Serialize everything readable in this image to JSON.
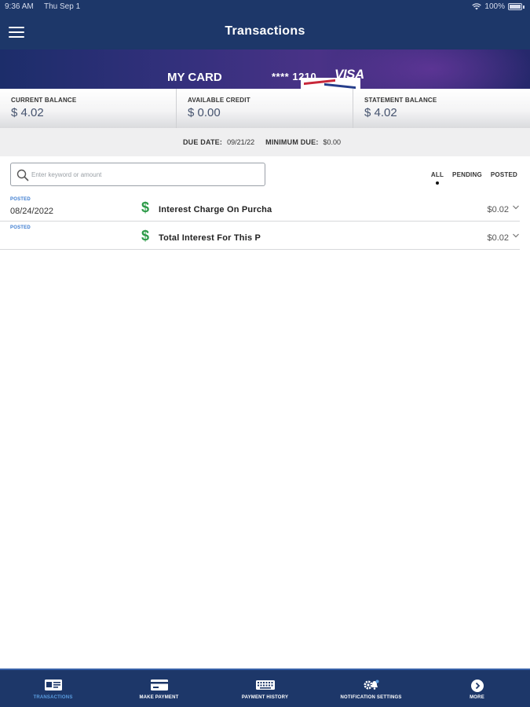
{
  "status_bar": {
    "time": "9:36 AM",
    "date": "Thu Sep 1",
    "battery": "100%"
  },
  "header": {
    "title": "Transactions"
  },
  "card": {
    "name": "MY CARD",
    "number": "**** 1210",
    "brand": "VISA"
  },
  "balances": [
    {
      "label": "CURRENT BALANCE",
      "value": "$ 4.02"
    },
    {
      "label": "AVAILABLE CREDIT",
      "value": "$ 0.00"
    },
    {
      "label": "STATEMENT BALANCE",
      "value": "$ 4.02"
    }
  ],
  "due": {
    "due_label": "DUE DATE:",
    "due_value": "09/21/22",
    "min_label": "MINIMUM DUE:",
    "min_value": "$0.00"
  },
  "search": {
    "placeholder": "Enter keyword or amount"
  },
  "filters": [
    {
      "label": "ALL",
      "active": true
    },
    {
      "label": "PENDING",
      "active": false
    },
    {
      "label": "POSTED",
      "active": false
    }
  ],
  "transactions": [
    {
      "status": "POSTED",
      "date": "08/24/2022",
      "description": "Interest Charge On Purcha",
      "amount": "$0.02"
    },
    {
      "status": "POSTED",
      "date": "",
      "description": "Total Interest For This P",
      "amount": "$0.02"
    }
  ],
  "tabs": [
    {
      "label": "TRANSACTIONS",
      "icon": "card-list-icon",
      "active": true
    },
    {
      "label": "MAKE PAYMENT",
      "icon": "card-icon",
      "active": false
    },
    {
      "label": "PAYMENT HISTORY",
      "icon": "keyboard-history-icon",
      "active": false
    },
    {
      "label": "NOTIFICATION SETTINGS",
      "icon": "gear-bell-icon",
      "active": false
    },
    {
      "label": "MORE",
      "icon": "chevron-circle-icon",
      "active": false
    }
  ],
  "colors": {
    "header": "#1d3769",
    "accent": "#3b7bd0",
    "dollar": "#2b9a47"
  }
}
